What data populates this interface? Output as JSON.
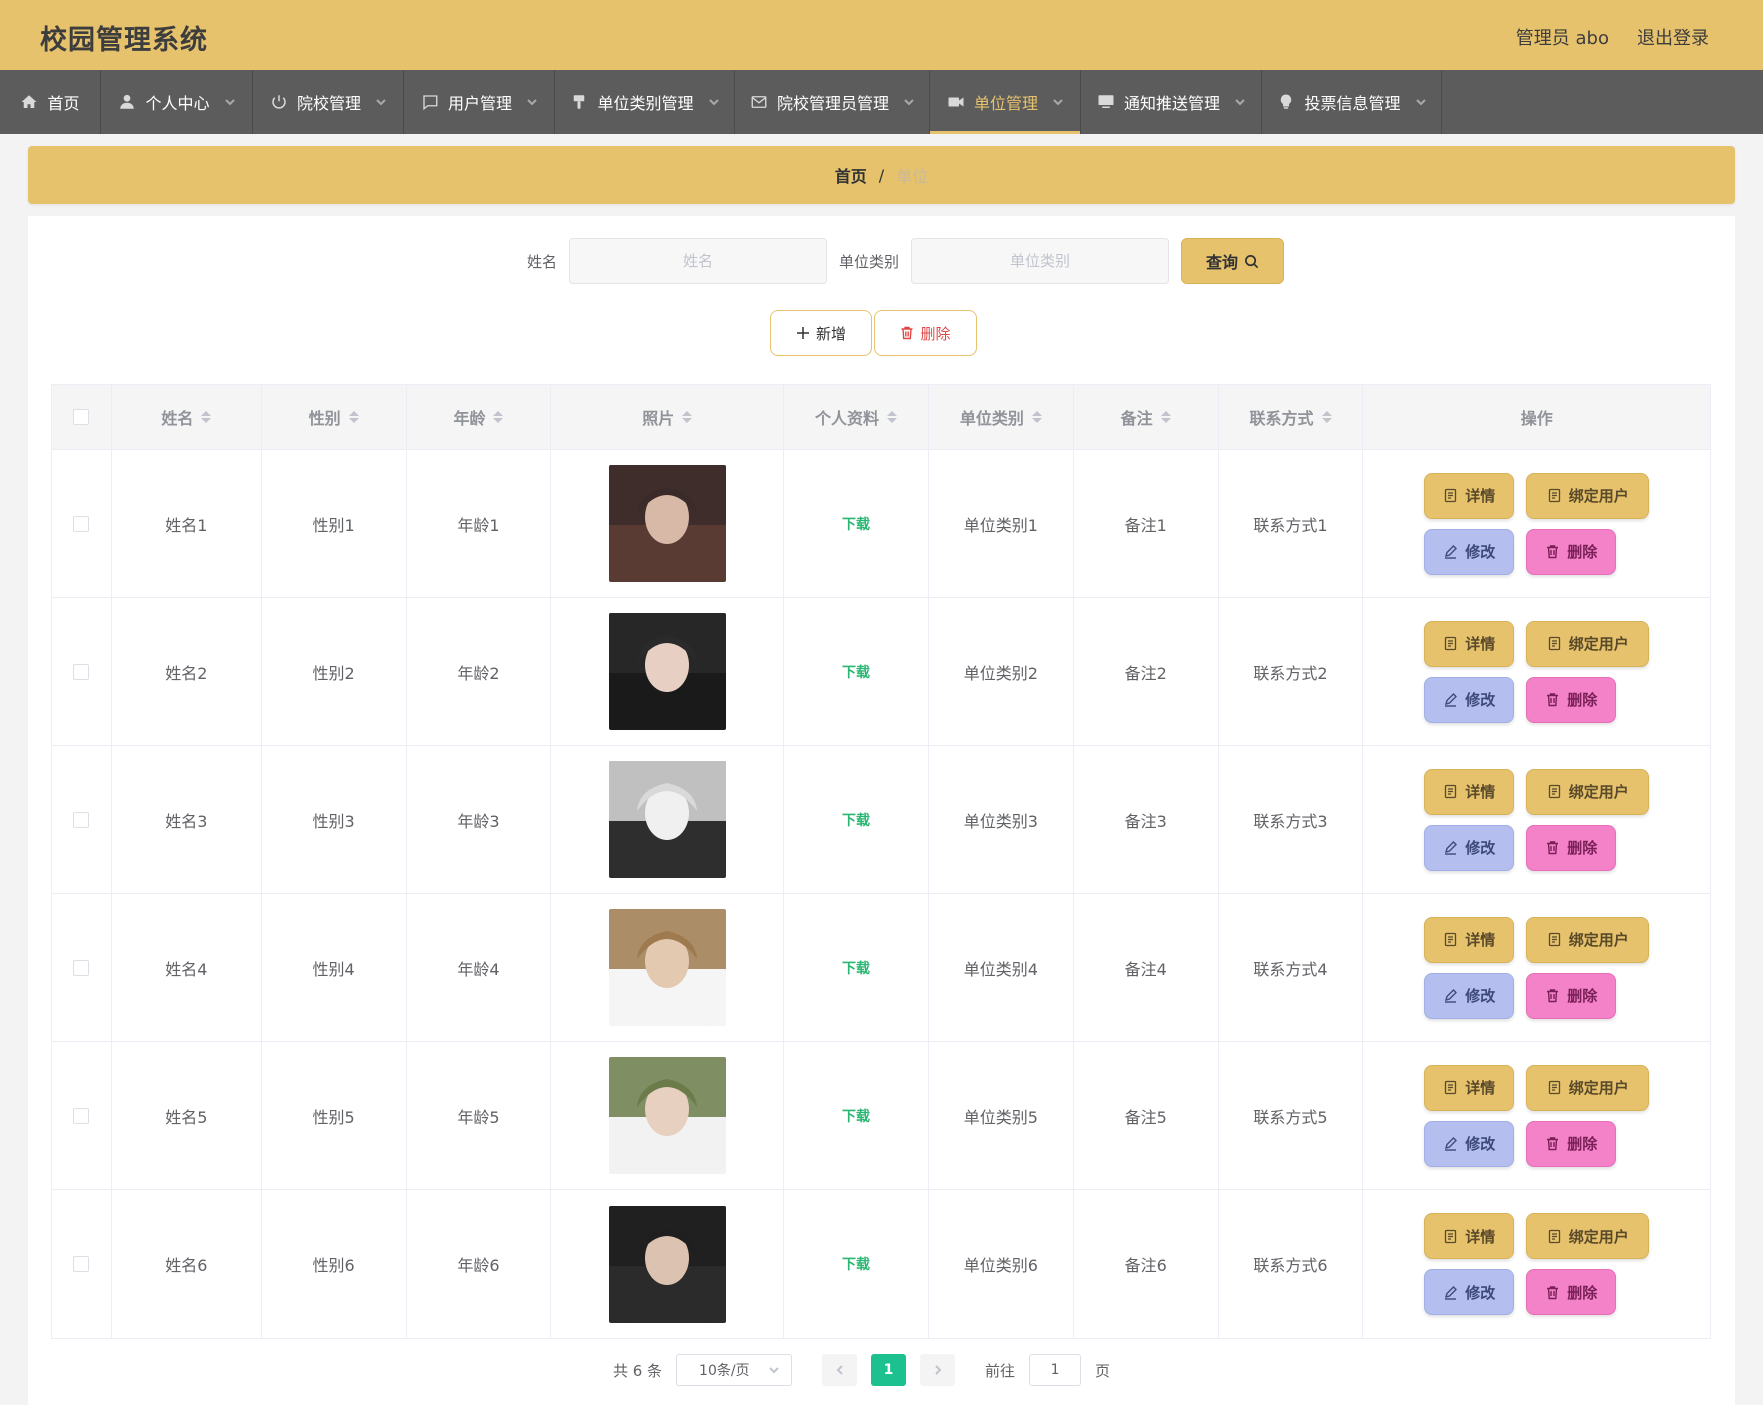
{
  "header": {
    "title": "校园管理系统",
    "user_label": "管理员 abo",
    "logout_label": "退出登录",
    "bg_color": "#e6c26d"
  },
  "nav": {
    "items": [
      {
        "label": "首页",
        "icon": "home-icon"
      },
      {
        "label": "个人中心",
        "icon": "user-icon"
      },
      {
        "label": "院校管理",
        "icon": "power-icon"
      },
      {
        "label": "用户管理",
        "icon": "message-icon"
      },
      {
        "label": "单位类别管理",
        "icon": "brush-icon"
      },
      {
        "label": "院校管理员管理",
        "icon": "mail-icon"
      },
      {
        "label": "单位管理",
        "icon": "camera-icon",
        "active": true
      },
      {
        "label": "通知推送管理",
        "icon": "monitor-icon"
      },
      {
        "label": "投票信息管理",
        "icon": "bulb-icon"
      }
    ]
  },
  "breadcrumb": {
    "home": "首页",
    "separator": "/",
    "current": "单位"
  },
  "search": {
    "name_label": "姓名",
    "name_placeholder": "姓名",
    "category_label": "单位类别",
    "category_placeholder": "单位类别",
    "query_label": "查询"
  },
  "actions": {
    "add_label": "新增",
    "delete_label": "删除"
  },
  "table": {
    "columns": [
      "姓名",
      "性别",
      "年龄",
      "照片",
      "个人资料",
      "单位类别",
      "备注",
      "联系方式",
      "操作"
    ],
    "rows": [
      {
        "name": "姓名1",
        "gender": "性别1",
        "age": "年龄1",
        "file": "下载",
        "category": "单位类别1",
        "note": "备注1",
        "contact": "联系方式1"
      },
      {
        "name": "姓名2",
        "gender": "性别2",
        "age": "年龄2",
        "file": "下载",
        "category": "单位类别2",
        "note": "备注2",
        "contact": "联系方式2"
      },
      {
        "name": "姓名3",
        "gender": "性别3",
        "age": "年龄3",
        "file": "下载",
        "category": "单位类别3",
        "note": "备注3",
        "contact": "联系方式3"
      },
      {
        "name": "姓名4",
        "gender": "性别4",
        "age": "年龄4",
        "file": "下载",
        "category": "单位类别4",
        "note": "备注4",
        "contact": "联系方式4"
      },
      {
        "name": "姓名5",
        "gender": "性别5",
        "age": "年龄5",
        "file": "下载",
        "category": "单位类别5",
        "note": "备注5",
        "contact": "联系方式5"
      },
      {
        "name": "姓名6",
        "gender": "性别6",
        "age": "年龄6",
        "file": "下载",
        "category": "单位类别6",
        "note": "备注6",
        "contact": "联系方式6"
      }
    ],
    "row_actions": {
      "detail": "详情",
      "bind": "绑定用户",
      "edit": "修改",
      "remove": "删除"
    }
  },
  "pagination": {
    "total_text": "共 6 条",
    "page_size": "10条/页",
    "current_page": "1",
    "goto_label": "前往",
    "goto_value": "1",
    "page_suffix": "页"
  },
  "photo_palettes": [
    [
      "#3a2b2a",
      "#d8b9a8",
      "#5a3b34"
    ],
    [
      "#2a2a2a",
      "#e8cfc4",
      "#1a1a1a"
    ],
    [
      "#d9d9d9",
      "#f0f0f0",
      "#2e2e2e"
    ],
    [
      "#9e7a4e",
      "#e2c9b0",
      "#f5f5f5"
    ],
    [
      "#6b7c4a",
      "#e8d0c0",
      "#f2f2f2"
    ],
    [
      "#1f1f1f",
      "#dcc2b0",
      "#2b2b2b"
    ]
  ]
}
